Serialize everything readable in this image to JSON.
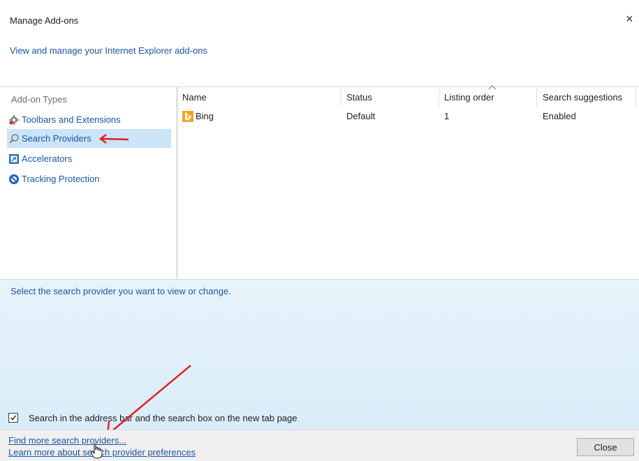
{
  "window": {
    "title": "Manage Add-ons",
    "subtitle": "View and manage your Internet Explorer add-ons",
    "close_glyph": "×"
  },
  "addon_types": {
    "header": "Add-on Types",
    "items": [
      {
        "label": "Toolbars and Extensions",
        "icon": "gear-icon"
      },
      {
        "label": "Search Providers",
        "icon": "search-icon"
      },
      {
        "label": "Accelerators",
        "icon": "accelerator-icon"
      },
      {
        "label": "Tracking Protection",
        "icon": "tracking-protection-icon"
      }
    ],
    "selected_index": 1
  },
  "table": {
    "columns": [
      "Name",
      "Status",
      "Listing order",
      "Search suggestions"
    ],
    "sorted_column_indicator": "^",
    "rows": [
      {
        "name": "Bing",
        "status": "Default",
        "listing_order": "1",
        "search_suggestions": "Enabled",
        "icon": "bing-icon"
      }
    ]
  },
  "details": {
    "text": "Select the search provider you want to view or change."
  },
  "options": {
    "checkbox_label": "Search in the address bar and the search box on the new tab page",
    "checkbox_checked": true
  },
  "footer": {
    "link_find": "Find more search providers...",
    "link_learn": "Learn more about search provider preferences",
    "close_button": "Close"
  },
  "colors": {
    "link": "#1a55a8",
    "selection": "#cce4f7",
    "arrow_annotation": "#e02020"
  }
}
